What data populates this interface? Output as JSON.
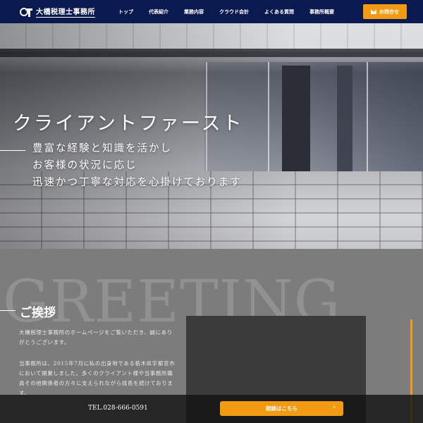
{
  "header": {
    "logo_text": "大橋税理士事務所",
    "nav": [
      {
        "label": "トップ"
      },
      {
        "label": "代表紹介"
      },
      {
        "label": "業務内容"
      },
      {
        "label": "クラウド会計"
      },
      {
        "label": "よくある質問"
      },
      {
        "label": "事務所概要"
      }
    ],
    "contact_label": "お問合せ",
    "contact_icon": "mail-icon"
  },
  "hero": {
    "title": "クライアントファースト",
    "lines": [
      "豊富な経験と知識を活かし",
      "お客様の状況に応じ",
      "迅速かつ丁寧な対応を心掛けております"
    ]
  },
  "greeting": {
    "bg_word": "GREETING",
    "title": "ご挨拶",
    "paragraphs": [
      "大橋税理士事務所のホームページをご覧いただき、誠にありがとうございます。",
      "当事務所は、2015年7月に私の出身地である栃木県宇都宮市において開業しました。多くのクライアント様や当事務所職員その他関係者の方々に支えられながら成長を続けております。"
    ]
  },
  "bottom_bar": {
    "tel": "TEL.028-666-0591",
    "consult_label": "相談はこちら",
    "consult_icon": "chevron-right-icon"
  },
  "colors": {
    "header_bg": "#0a1a50",
    "accent": "#f29a12",
    "section_bg": "#7c7c7c"
  }
}
